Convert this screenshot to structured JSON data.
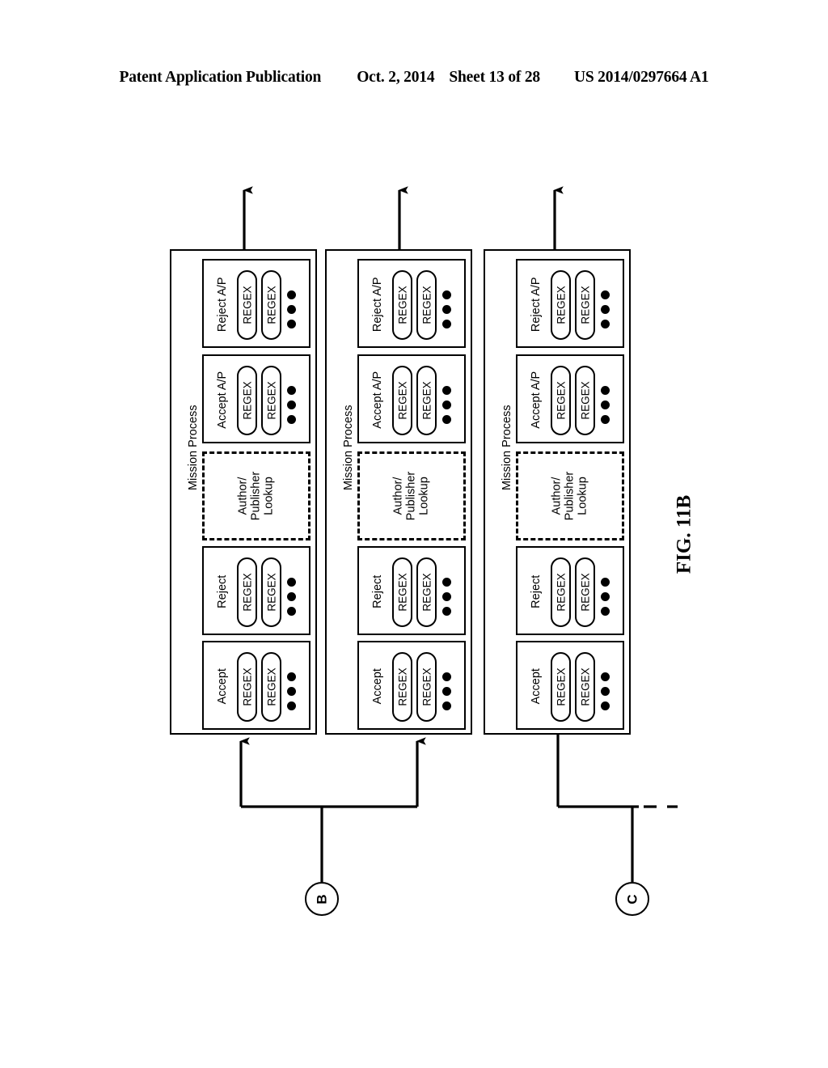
{
  "header": {
    "publication": "Patent Application Publication",
    "date": "Oct. 2, 2014",
    "sheet": "Sheet 13 of 28",
    "patent_number": "US 2014/0297664 A1"
  },
  "figure": {
    "label": "FIG. 11B"
  },
  "labels": {
    "mission_process": "Mission Process",
    "reject_ap": "Reject A/P",
    "accept_ap": "Accept A/P",
    "reject": "Reject",
    "accept": "Accept",
    "regex": "REGEX",
    "author_publisher_lookup_line1": "Author/",
    "author_publisher_lookup_line2": "Publisher",
    "author_publisher_lookup_line3": "Lookup"
  },
  "connectors": [
    {
      "id": "connector-b",
      "label": "B"
    },
    {
      "id": "connector-c",
      "label": "C"
    }
  ],
  "columns": [
    {
      "name": "mission-process-1",
      "title": "Mission Process",
      "groups": [
        {
          "name": "reject-ap",
          "label": "Reject A/P",
          "pills": [
            "REGEX",
            "REGEX"
          ],
          "has_ellipsis": true,
          "dashed": false
        },
        {
          "name": "accept-ap",
          "label": "Accept A/P",
          "pills": [
            "REGEX",
            "REGEX"
          ],
          "has_ellipsis": true,
          "dashed": false
        },
        {
          "name": "author-publisher-lookup",
          "label": "Author/ Publisher Lookup",
          "pills": [],
          "has_ellipsis": false,
          "dashed": true
        },
        {
          "name": "reject",
          "label": "Reject",
          "pills": [
            "REGEX",
            "REGEX"
          ],
          "has_ellipsis": true,
          "dashed": false
        },
        {
          "name": "accept",
          "label": "Accept",
          "pills": [
            "REGEX",
            "REGEX"
          ],
          "has_ellipsis": true,
          "dashed": false
        }
      ]
    },
    {
      "name": "mission-process-2",
      "title": "Mission Process",
      "groups": [
        {
          "name": "reject-ap",
          "label": "Reject A/P",
          "pills": [
            "REGEX",
            "REGEX"
          ],
          "has_ellipsis": true,
          "dashed": false
        },
        {
          "name": "accept-ap",
          "label": "Accept A/P",
          "pills": [
            "REGEX",
            "REGEX"
          ],
          "has_ellipsis": true,
          "dashed": false
        },
        {
          "name": "author-publisher-lookup",
          "label": "Author/ Publisher Lookup",
          "pills": [],
          "has_ellipsis": false,
          "dashed": true
        },
        {
          "name": "reject",
          "label": "Reject",
          "pills": [
            "REGEX",
            "REGEX"
          ],
          "has_ellipsis": true,
          "dashed": false
        },
        {
          "name": "accept",
          "label": "Accept",
          "pills": [
            "REGEX",
            "REGEX"
          ],
          "has_ellipsis": true,
          "dashed": false
        }
      ]
    },
    {
      "name": "mission-process-3",
      "title": "Mission Process",
      "groups": [
        {
          "name": "reject-ap",
          "label": "Reject A/P",
          "pills": [
            "REGEX",
            "REGEX"
          ],
          "has_ellipsis": true,
          "dashed": false
        },
        {
          "name": "accept-ap",
          "label": "Accept A/P",
          "pills": [
            "REGEX",
            "REGEX"
          ],
          "has_ellipsis": true,
          "dashed": false
        },
        {
          "name": "author-publisher-lookup",
          "label": "Author/ Publisher Lookup",
          "pills": [],
          "has_ellipsis": false,
          "dashed": true
        },
        {
          "name": "reject",
          "label": "Reject",
          "pills": [
            "REGEX",
            "REGEX"
          ],
          "has_ellipsis": true,
          "dashed": false
        },
        {
          "name": "accept",
          "label": "Accept",
          "pills": [
            "REGEX",
            "REGEX"
          ],
          "has_ellipsis": true,
          "dashed": false
        }
      ]
    }
  ],
  "colors": {
    "ink": "#000000",
    "paper": "#ffffff"
  }
}
